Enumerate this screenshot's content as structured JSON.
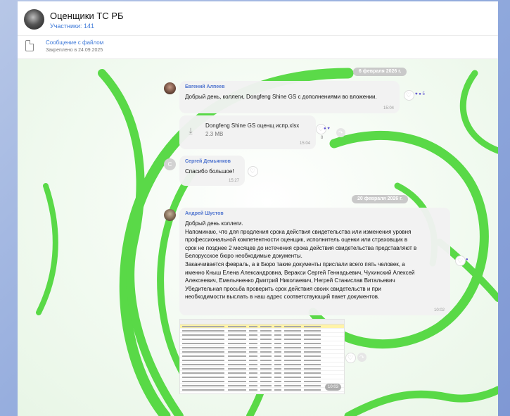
{
  "chat": {
    "title": "Оценщики ТС РБ",
    "subtitle": "Участники: 141",
    "avatar_icon": "group-avatar"
  },
  "pinned": {
    "title": "Сообщение с файлом",
    "subtitle": "Закреплено в 24.09.2025",
    "icon": "file-icon"
  },
  "dates": {
    "first": "6 февраля 2026 г.",
    "second": "20 февраля 2026 г."
  },
  "messages": [
    {
      "sender": "Евгений Алпеев",
      "text": "Добрый день, коллеги,  Dongfeng Shine GS с дополнениями во вложении.",
      "time": "15:04",
      "reactions": "♥ ● 5",
      "file": {
        "name": "Dongfeng Shine GS оценщ испр.xlsx",
        "size": "2.3 MB",
        "time": "15:04",
        "reactions": "●  ♥",
        "reaction_count": "8"
      }
    },
    {
      "sender": "Сергей Демьянков",
      "avatar_letter": "С",
      "text": "Спасибо большое!",
      "time": "15:27"
    },
    {
      "sender": "Андрей Шустов",
      "text": "Добрый день коллеги.\nНапоминаю, что для продления срока действия свидетельства или изменения уровня\nпрофессиональной компетентности оценщик, исполнитель оценки или страховщик в\nсрок не позднее 2 месяцев до истечения срока действия свидетельства представляют в\nБелорусское бюро необходимые документы.\nЗаканчивается февраль, а в Бюро такие документы прислали всего пять человек, а\nименно Кныш Елена Александровна, Веракси Сергей Геннадьевич, Чухинский Алексей\nАлексеевич, Емельяненко Дмитрий Николаевич, Негрей Станислав Витальевич\nУбедительная просьба проверить срок действия своих свидетельств и при\nнеобходимости выслать в наш адрес соответствующий пакет документов.",
      "time": "10:02",
      "reactions": "●",
      "image_time": "10:03"
    }
  ],
  "colors": {
    "accent": "#3f7ad8",
    "sender": "#4f74cf",
    "swirl": "#3fd42a",
    "reaction": "#5b4fd0"
  }
}
